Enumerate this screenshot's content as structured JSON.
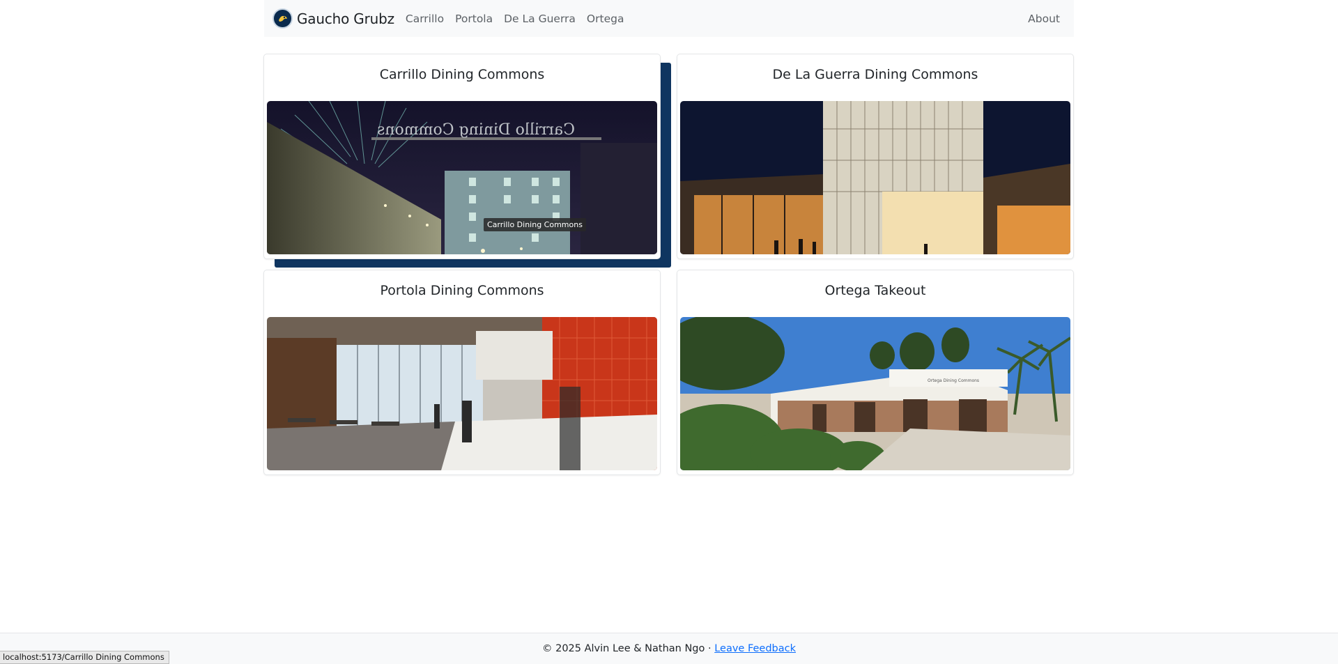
{
  "navbar": {
    "brand": "Gaucho Grubz",
    "links": [
      "Carrillo",
      "Portola",
      "De La Guerra",
      "Ortega"
    ],
    "about": "About"
  },
  "cards": [
    {
      "title": "Carrillo Dining Commons",
      "image_alt": "Carrillo Dining Commons"
    },
    {
      "title": "De La Guerra Dining Commons",
      "image_alt": "De La Guerra Dining Commons"
    },
    {
      "title": "Portola Dining Commons",
      "image_alt": "Portola Dining Commons"
    },
    {
      "title": "Ortega Takeout",
      "image_alt": "Ortega Takeout"
    }
  ],
  "carrillo_sign": "Carrillo Dining Commons",
  "tooltip": "Carrillo Dining Commons",
  "footer": {
    "copyright": "© 2025 Alvin Lee & Nathan Ngo · ",
    "feedback_link": "Leave Feedback"
  },
  "status_bar": "localhost:5173/Carrillo Dining Commons",
  "colors": {
    "navbar_bg": "#f8f9fa",
    "hover_accent": "#0f3560",
    "link": "#0d6efd"
  }
}
